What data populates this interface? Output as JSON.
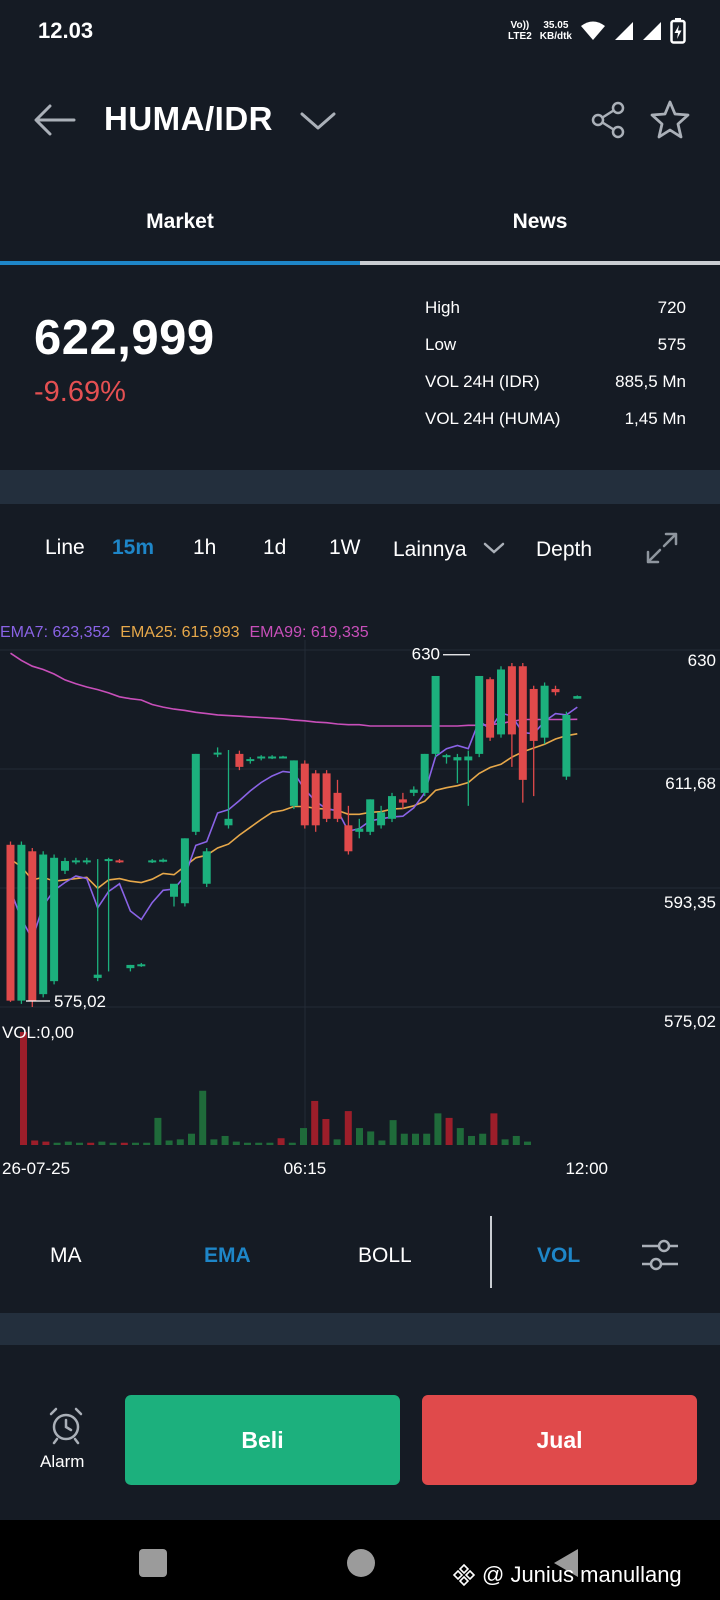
{
  "status_bar": {
    "time": "12.03",
    "volte": "Vo))",
    "lte": "LTE2",
    "speed_value": "35.05",
    "speed_unit": "KB/dtk"
  },
  "header": {
    "pair": "HUMA/IDR"
  },
  "tabs": [
    {
      "label": "Market",
      "active": true
    },
    {
      "label": "News",
      "active": false
    }
  ],
  "ticker": {
    "price": "622,999",
    "change": "-9.69%",
    "stats": [
      {
        "label": "High",
        "value": "720"
      },
      {
        "label": "Low",
        "value": "575"
      },
      {
        "label": "VOL 24H (IDR)",
        "value": "885,5 Mn"
      },
      {
        "label": "VOL 24H (HUMA)",
        "value": "1,45 Mn"
      }
    ]
  },
  "intervals": {
    "line": "Line",
    "m15": "15m",
    "h1": "1h",
    "d1": "1d",
    "w1": "1W",
    "more": "Lainnya",
    "depth": "Depth"
  },
  "ema_legend": {
    "ema7": "EMA7: 623,352",
    "ema25": "EMA25: 615,993",
    "ema99": "EMA99: 619,335"
  },
  "chart_data": {
    "type": "candlestick",
    "y_axis_labels": [
      "630",
      "611,68",
      "593,35",
      "575,02"
    ],
    "ylim": [
      575.02,
      630
    ],
    "x_axis_labels": [
      "26-07-25",
      "06:15",
      "12:00"
    ],
    "high_marker": "630",
    "low_marker": "575,02",
    "volume_label": "VOL:0,00",
    "colors": {
      "up": "#1cb07d",
      "down": "#e04a4b",
      "ema7": "#8a63e6",
      "ema25": "#e7a84a",
      "ema99": "#c84fba"
    },
    "candles": [
      {
        "o": 600,
        "h": 600.5,
        "c": 576,
        "l": 575.8
      },
      {
        "o": 576,
        "h": 600.5,
        "c": 600,
        "l": 575.5
      },
      {
        "o": 599,
        "h": 599.5,
        "c": 576,
        "l": 575.02
      },
      {
        "o": 577,
        "h": 599,
        "c": 598.5,
        "l": 576.5
      },
      {
        "o": 579,
        "h": 598.5,
        "c": 598,
        "l": 578.5
      },
      {
        "o": 596,
        "h": 598,
        "c": 597.5,
        "l": 595.5
      },
      {
        "o": 597.5,
        "h": 598,
        "c": 597.6,
        "l": 597
      },
      {
        "o": 597.5,
        "h": 598,
        "c": 597.6,
        "l": 597
      },
      {
        "o": 579.5,
        "h": 597.8,
        "c": 580,
        "l": 579
      },
      {
        "o": 597.6,
        "h": 598,
        "c": 597.8,
        "l": 580.5
      },
      {
        "o": 597.6,
        "h": 597.8,
        "c": 597.5,
        "l": 597.2
      },
      {
        "o": 581,
        "h": 581.5,
        "c": 581.5,
        "l": 580.5
      },
      {
        "o": 581.5,
        "h": 581.8,
        "c": 581.6,
        "l": 581.2
      },
      {
        "o": 597.5,
        "h": 597.8,
        "c": 597.6,
        "l": 597.2
      },
      {
        "o": 597.6,
        "h": 597.9,
        "c": 597.7,
        "l": 597.3
      },
      {
        "o": 592,
        "h": 593,
        "c": 594,
        "l": 590.5
      },
      {
        "o": 591,
        "h": 601,
        "c": 601,
        "l": 590.5
      },
      {
        "o": 602,
        "h": 614,
        "c": 614,
        "l": 601.5
      },
      {
        "o": 594,
        "h": 599.5,
        "c": 599,
        "l": 593.5
      },
      {
        "o": 614,
        "h": 615,
        "c": 614.2,
        "l": 613.5
      },
      {
        "o": 603,
        "h": 614.6,
        "c": 604,
        "l": 602.5
      },
      {
        "o": 614,
        "h": 614.5,
        "c": 612,
        "l": 611.5
      },
      {
        "o": 613,
        "h": 613.5,
        "c": 613.2,
        "l": 612.5
      },
      {
        "o": 613.5,
        "h": 613.8,
        "c": 613.6,
        "l": 613
      },
      {
        "o": 613.5,
        "h": 613.8,
        "c": 613.6,
        "l": 613.2
      },
      {
        "o": 613.5,
        "h": 613.7,
        "c": 613.6,
        "l": 613.3
      },
      {
        "o": 606,
        "h": 613,
        "c": 613,
        "l": 605.5
      },
      {
        "o": 612.5,
        "h": 613,
        "c": 603,
        "l": 602.5
      },
      {
        "o": 611,
        "h": 611.5,
        "c": 603,
        "l": 602
      },
      {
        "o": 611,
        "h": 611.5,
        "c": 604,
        "l": 603.5
      },
      {
        "o": 608,
        "h": 610,
        "c": 604,
        "l": 603.5
      },
      {
        "o": 603,
        "h": 606,
        "c": 599,
        "l": 598.5
      },
      {
        "o": 602,
        "h": 604,
        "c": 602.5,
        "l": 601
      },
      {
        "o": 602,
        "h": 607,
        "c": 607,
        "l": 601.5
      },
      {
        "o": 603,
        "h": 606,
        "c": 605,
        "l": 602.5
      },
      {
        "o": 604,
        "h": 608,
        "c": 607.5,
        "l": 603.5
      },
      {
        "o": 607,
        "h": 608,
        "c": 606.5,
        "l": 605.5
      },
      {
        "o": 608,
        "h": 609,
        "c": 608.5,
        "l": 607.5
      },
      {
        "o": 608,
        "h": 614,
        "c": 614,
        "l": 607.5
      },
      {
        "o": 614,
        "h": 626,
        "c": 626,
        "l": 613.5
      },
      {
        "o": 613.5,
        "h": 614,
        "c": 613.8,
        "l": 612.5
      },
      {
        "o": 613,
        "h": 614,
        "c": 613.5,
        "l": 609.5
      },
      {
        "o": 613,
        "h": 614.5,
        "c": 613.6,
        "l": 606
      },
      {
        "o": 614,
        "h": 626,
        "c": 626,
        "l": 613.5
      },
      {
        "o": 625.5,
        "h": 625.8,
        "c": 616.5,
        "l": 616
      },
      {
        "o": 617,
        "h": 627.5,
        "c": 627,
        "l": 616.5
      },
      {
        "o": 627.5,
        "h": 628,
        "c": 617,
        "l": 612
      },
      {
        "o": 627.5,
        "h": 628,
        "c": 610,
        "l": 606.5
      },
      {
        "o": 624,
        "h": 624.5,
        "c": 616,
        "l": 607.5
      },
      {
        "o": 616.5,
        "h": 625,
        "c": 624.5,
        "l": 615.5
      },
      {
        "o": 624,
        "h": 624.5,
        "c": 623.5,
        "l": 623
      },
      {
        "o": 610.5,
        "h": 620.5,
        "c": 620,
        "l": 610
      },
      {
        "o": 622.5,
        "h": 623,
        "c": 622.9,
        "l": 622.5
      }
    ],
    "ema7": [
      593,
      588.6,
      585.5,
      590.6,
      593,
      594.2,
      595.2,
      594.8,
      590.3,
      592.8,
      594,
      589.8,
      588.5,
      591.1,
      593,
      593.2,
      595.2,
      599.9,
      600.5,
      604.9,
      605.4,
      606.8,
      608.3,
      609.6,
      610.6,
      611.3,
      611.1,
      608.5,
      606.7,
      605.5,
      605.3,
      602.1,
      602.5,
      603.7,
      604,
      604.3,
      604.4,
      605.7,
      608,
      613.6,
      614.8,
      615.3,
      614.8,
      619.1,
      617.8,
      620.3,
      619.8,
      617.3,
      617.1,
      619,
      620.2,
      620,
      621.2
    ],
    "ema25": [
      597.8,
      596.6,
      594.6,
      595,
      594.4,
      594.6,
      594.8,
      595,
      593.3,
      594.6,
      594.8,
      594.4,
      594.2,
      594.7,
      595.6,
      595.4,
      596.7,
      598,
      598.4,
      599.5,
      600.1,
      601.5,
      602.7,
      603.9,
      605,
      605.3,
      605.9,
      605.9,
      605.6,
      605.5,
      605.3,
      604.7,
      604.7,
      605,
      605.1,
      605.5,
      605.6,
      606,
      606.7,
      608.4,
      608.8,
      609.1,
      609.6,
      611,
      611.9,
      612.4,
      613.5,
      614.3,
      614.9,
      615.5,
      616.3,
      616.8,
      617.1
    ],
    "ema99": [
      629.5,
      628.4,
      627.5,
      627,
      626.3,
      625.4,
      624.8,
      624.3,
      623.9,
      623.4,
      622.8,
      622.5,
      622.3,
      621.6,
      621.2,
      620.9,
      620.7,
      620.4,
      620.2,
      620,
      619.9,
      619.8,
      619.7,
      619.6,
      619.5,
      619.4,
      619.2,
      619.1,
      618.9,
      618.8,
      618.6,
      618.5,
      618.5,
      618.3,
      618.3,
      618.3,
      618.3,
      618.3,
      618.3,
      618.3,
      618.3,
      618.3,
      618.4,
      618.4,
      618.5,
      618.7,
      619,
      619.3,
      619.3,
      619.3,
      619.3,
      619.3,
      619.335
    ],
    "volume": [
      {
        "v": 100,
        "dir": "down"
      },
      {
        "v": 4,
        "dir": "down"
      },
      {
        "v": 3,
        "dir": "down"
      },
      {
        "v": 2,
        "dir": "up"
      },
      {
        "v": 3,
        "dir": "up"
      },
      {
        "v": 2,
        "dir": "up"
      },
      {
        "v": 2,
        "dir": "down"
      },
      {
        "v": 3,
        "dir": "up"
      },
      {
        "v": 2,
        "dir": "up"
      },
      {
        "v": 2,
        "dir": "down"
      },
      {
        "v": 2,
        "dir": "up"
      },
      {
        "v": 2,
        "dir": "up"
      },
      {
        "v": 24,
        "dir": "up"
      },
      {
        "v": 4,
        "dir": "up"
      },
      {
        "v": 5,
        "dir": "up"
      },
      {
        "v": 10,
        "dir": "up"
      },
      {
        "v": 48,
        "dir": "up"
      },
      {
        "v": 5,
        "dir": "up"
      },
      {
        "v": 8,
        "dir": "up"
      },
      {
        "v": 3,
        "dir": "up"
      },
      {
        "v": 2,
        "dir": "up"
      },
      {
        "v": 2,
        "dir": "up"
      },
      {
        "v": 2,
        "dir": "up"
      },
      {
        "v": 6,
        "dir": "down"
      },
      {
        "v": 2,
        "dir": "up"
      },
      {
        "v": 15,
        "dir": "up"
      },
      {
        "v": 39,
        "dir": "down"
      },
      {
        "v": 23,
        "dir": "down"
      },
      {
        "v": 5,
        "dir": "up"
      },
      {
        "v": 30,
        "dir": "down"
      },
      {
        "v": 15,
        "dir": "up"
      },
      {
        "v": 12,
        "dir": "up"
      },
      {
        "v": 4,
        "dir": "up"
      },
      {
        "v": 22,
        "dir": "up"
      },
      {
        "v": 10,
        "dir": "up"
      },
      {
        "v": 10,
        "dir": "up"
      },
      {
        "v": 10,
        "dir": "up"
      },
      {
        "v": 28,
        "dir": "up"
      },
      {
        "v": 24,
        "dir": "down"
      },
      {
        "v": 15,
        "dir": "up"
      },
      {
        "v": 8,
        "dir": "up"
      },
      {
        "v": 10,
        "dir": "up"
      },
      {
        "v": 28,
        "dir": "down"
      },
      {
        "v": 5,
        "dir": "up"
      },
      {
        "v": 8,
        "dir": "up"
      },
      {
        "v": 3,
        "dir": "up"
      }
    ]
  },
  "indicators": {
    "ma": "MA",
    "ema": "EMA",
    "boll": "BOLL",
    "vol": "VOL"
  },
  "actions": {
    "alarm": "Alarm",
    "buy": "Beli",
    "sell": "Jual"
  },
  "watermark": "@ Junius manullang",
  "colors": {
    "background": "#151b24",
    "accent": "#1e86c8",
    "buy": "#1cb07d",
    "sell": "#e04a4b"
  }
}
